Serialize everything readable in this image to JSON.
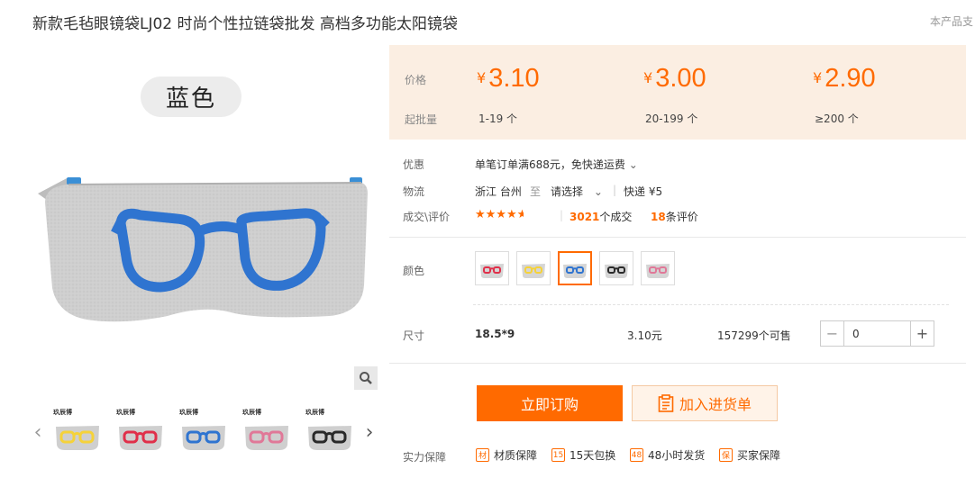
{
  "product": {
    "title": "新款毛毡眼镜袋LJ02 时尚个性拉链袋批发 高档多功能太阳镜袋",
    "support_note": "本产品支"
  },
  "gallery": {
    "color_pill": "蓝色",
    "thumb_brand": "玖辰博",
    "thumb_colors": [
      "#f5d23a",
      "#e0304a",
      "#2f74d0",
      "#e07898",
      "#2a2a2a"
    ]
  },
  "price_box": {
    "price_label": "价格",
    "moq_label": "起批量",
    "currency": "¥",
    "tiers": [
      {
        "price": "3.10",
        "range": "1-19 个"
      },
      {
        "price": "3.00",
        "range": "20-199 个"
      },
      {
        "price": "2.90",
        "range": "≥200 个"
      }
    ]
  },
  "info": {
    "promo_label": "优惠",
    "promo_text": "单笔订单满688元，免快递运费",
    "logistics_label": "物流",
    "origin": "浙江 台州",
    "to": "至",
    "destination": "请选择",
    "shipping": "快递 ¥5",
    "deals_label": "成交\\评价",
    "deals_count": "3021",
    "deals_suffix": "个成交",
    "reviews_count": "18",
    "reviews_suffix": "条评价",
    "rating": 4.5
  },
  "options": {
    "color_label": "颜色",
    "swatch_colors": [
      "#e0304a",
      "#f5d23a",
      "#2f74d0",
      "#2a2a2a",
      "#e07898"
    ],
    "selected_index": 2,
    "size_label": "尺寸",
    "size_value": "18.5*9",
    "unit_price": "3.10元",
    "stock": "157299个可售",
    "quantity": "0"
  },
  "actions": {
    "order": "立即订购",
    "add_cart": "加入进货单"
  },
  "guarantees": {
    "label": "实力保障",
    "items": [
      {
        "icon": "材",
        "text": "材质保障"
      },
      {
        "icon": "15",
        "text": "15天包换"
      },
      {
        "icon": "48",
        "text": "48小时发货"
      },
      {
        "icon": "保",
        "text": "买家保障"
      }
    ]
  },
  "colors": {
    "accent": "#ff6a00",
    "price_bg": "#fbeee2"
  }
}
